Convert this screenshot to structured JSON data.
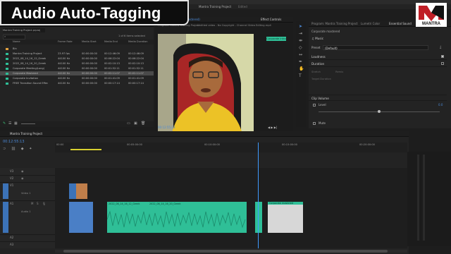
{
  "window": {
    "title": "Adobe Premiere Pro 2023 - C:\\Users\\...\\Desktop\\Mantra Training Project.prproj *"
  },
  "overlay": {
    "title": "Audio Auto-Tagging"
  },
  "header": {
    "workspace_label": "Mantra Training Project",
    "edited_label": "Edited"
  },
  "brand": {
    "logo_text": "MANTRA",
    "accent": "#c01e26"
  },
  "project_panel": {
    "tabs": [
      "Project: Mantra Training Project",
      "Media Browser",
      "Libraries",
      "Info"
    ],
    "path": "Mantra Training Project.prproj",
    "items_selected": "1 of 6 items selected",
    "columns": [
      "Name",
      "Frame Rate",
      "Media Start",
      "Media End",
      "Media Duration"
    ],
    "rows": [
      {
        "name": "Bin",
        "rate": "",
        "start": "",
        "end": "",
        "dur": "",
        "color": "#e0a040"
      },
      {
        "name": "Mantra Training Project",
        "rate": "23.97 fps",
        "start": "00:00:00:00",
        "end": "00:12:46:09",
        "dur": "00:12:46:09",
        "color": "#2fbf97"
      },
      {
        "name": "2022_08_14_16_12_Greek",
        "rate": "44100 Hz",
        "start": "00:00:00:00",
        "end": "00:06:22:04",
        "dur": "00:06:22:04",
        "color": "#2fbf97"
      },
      {
        "name": "2022_08_14_16_20_Greek",
        "rate": "44100 Hz",
        "start": "00:00:00:00",
        "end": "00:02:10:13",
        "dur": "00:02:10:13",
        "color": "#2fbf97"
      },
      {
        "name": "Corporate Meeting(Long)",
        "rate": "44100 Hz",
        "start": "00:00:00:00",
        "end": "00:01:52:11",
        "dur": "00:01:52:11",
        "color": "#2fbf97"
      },
      {
        "name": "Corporate Mastered",
        "rate": "44100 Hz",
        "start": "00:00:00:00",
        "end": "00:02:11:07",
        "dur": "00:02:11:07",
        "color": "#2fbf97"
      },
      {
        "name": "Corporate Invitation",
        "rate": "44100 Hz",
        "start": "00:00:00:00",
        "end": "00:01:41:09",
        "dur": "00:01:41:09",
        "color": "#2fbf97"
      },
      {
        "name": "FREE Transition Sound Effec",
        "rate": "44100 Hz",
        "start": "00:00:00:00",
        "end": "00:00:17:14",
        "dur": "00:00:17:14",
        "color": "#2fbf97"
      }
    ],
    "selected_index": 5
  },
  "program_monitor": {
    "tabs": [
      "Source: (Corporate mastered)",
      "Effect Controls",
      "Audio Clip Mixer: Mantra Training Project",
      "Metadata"
    ],
    "title": "Program: Mantra Training Project",
    "caption": "Untitled video - No Copyright - Channel Video Editing.mp4",
    "timecode": "00:12:55:13",
    "badge": "Corporate intro"
  },
  "essential_sound": {
    "tabs": [
      "Program: Mantra Training Project",
      "Lumetri Color",
      "Essential Sound",
      "Text"
    ],
    "clip": "Corporate mastered",
    "type": "Music",
    "preset_label": "Preset",
    "preset_value": "(Default)",
    "sections": [
      "Loudness",
      "Duration",
      "Clip Volume"
    ],
    "duration_opts": [
      "Stretch",
      "Remix"
    ],
    "target": "Target Duration",
    "level_label": "Level",
    "level_value": "0.0",
    "mute_label": "Mute"
  },
  "timeline": {
    "tab": "Mantra Training Project",
    "timecode": "00:12:55:13",
    "ruler_labels": [
      "00:00",
      "00:05:00:00",
      "00:10:00:00",
      "00:15:00:00",
      "00:20:00:00"
    ],
    "tracks": [
      "V3",
      "V2",
      "V1",
      "A1",
      "A2",
      "A3"
    ],
    "video_track_name": "Video 1",
    "audio_track_name": "Audio 1",
    "clip_label_1": "2022_08_14_16_12_Greek",
    "clip_label_2": "2022_08_14_16_20_Greek",
    "clip_label_3": "Corporate mastered",
    "colors": {
      "audio": "#2fbf97",
      "video": "#3c73b8",
      "playhead": "#3f9bff"
    }
  }
}
